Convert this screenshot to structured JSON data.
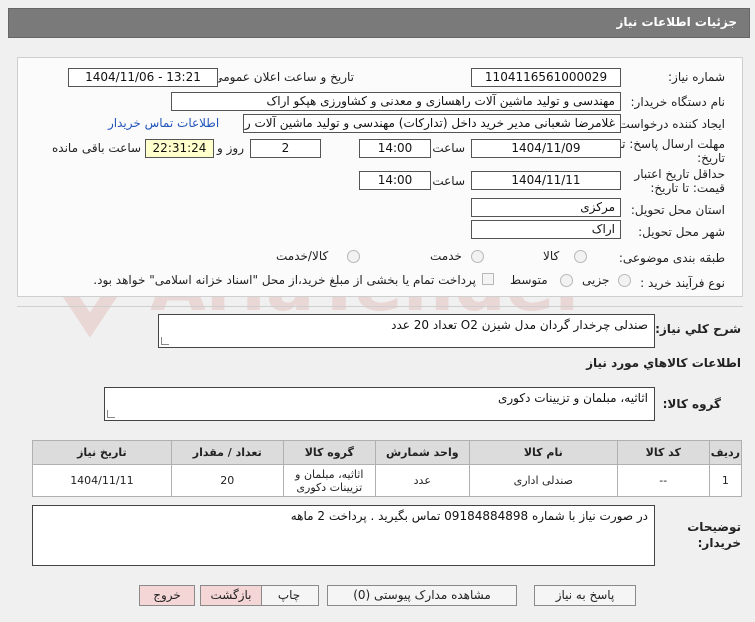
{
  "header": {
    "title": "جزئیات اطلاعات نیاز"
  },
  "fields": {
    "need_number_label": "شماره نیاز:",
    "need_number": "1104116561000029",
    "announce_label": "تاریخ و ساعت اعلان عمومی:",
    "announce_value": "1404/11/06 - 13:21",
    "buyer_org_label": "نام دستگاه خریدار:",
    "buyer_org": "مهندسی و تولید ماشین آلات راهسازی و معدنی و کشاورزی هپکو اراک",
    "creator_label": "ایجاد کننده درخواست:",
    "creator": "غلامرضا شعبانی مدیر خرید داخل (تدارکات) مهندسی و تولید ماشین آلات راهسا",
    "contact_link": "اطلاعات تماس خریدار",
    "deadline_label": "مهلت ارسال پاسخ: تا",
    "deadline_label2": "تاریخ:",
    "deadline_date": "1404/11/09",
    "time_label": "ساعت",
    "deadline_time": "14:00",
    "days_value": "2",
    "days_label": "روز و",
    "remaining_value": "22:31:24",
    "remaining_label": "ساعت باقی مانده",
    "validity_label": "حداقل تاریخ اعتبار",
    "validity_label2": "قیمت: تا تاریخ:",
    "validity_date": "1404/11/11",
    "validity_time": "14:00",
    "province_label": "استان محل تحویل:",
    "province": "مرکزی",
    "city_label": "شهر محل تحویل:",
    "city": "اراک",
    "category_label": "طبقه بندی موضوعی:",
    "category_options": [
      "کالا",
      "خدمت",
      "کالا/خدمت"
    ],
    "process_label": "نوع فرآیند خرید :",
    "process_options": [
      "جزیی",
      "متوسط"
    ],
    "payment_note": "پرداخت تمام یا بخشی از مبلغ خرید،از محل \"اسناد خزانه اسلامی\" خواهد بود."
  },
  "summary": {
    "label": "شرح كلي نياز:",
    "value": "صندلی چرخدار گردان مدل شیزن O2  تعداد 20 عدد"
  },
  "goods_info_title": "اطلاعات كالاهاي مورد نياز",
  "goods_group": {
    "label": "گروه کالا:",
    "value": "اثاثیه، مبلمان و تزیینات دکوری"
  },
  "table": {
    "headers": [
      "ردیف",
      "کد کالا",
      "نام کالا",
      "واحد شمارش",
      "گروه کالا",
      "تعداد / مقدار",
      "تاریخ نیاز"
    ],
    "rows": [
      [
        "1",
        "--",
        "صندلی اداری",
        "عدد",
        "اثاثیه، مبلمان و تزیینات دکوری",
        "20",
        "1404/11/11"
      ]
    ]
  },
  "buyer_notes": {
    "label": "توضیحات",
    "label2": "خریدار:",
    "value": "در صورت نیاز با شماره 09184884898 تماس بگیرید . پرداخت 2 ماهه"
  },
  "buttons": {
    "reply": "پاسخ به نیاز",
    "attachments": "مشاهده مدارک پیوستی (0)",
    "print": "چاپ",
    "back": "بازگشت",
    "exit": "خروج"
  },
  "watermark": "AriaTender.net",
  "colors": {
    "header": "#7a7a7a",
    "remaining_bg": "#ffffcc",
    "link": "#2255bb",
    "pink_button": "#f4d6d6"
  }
}
